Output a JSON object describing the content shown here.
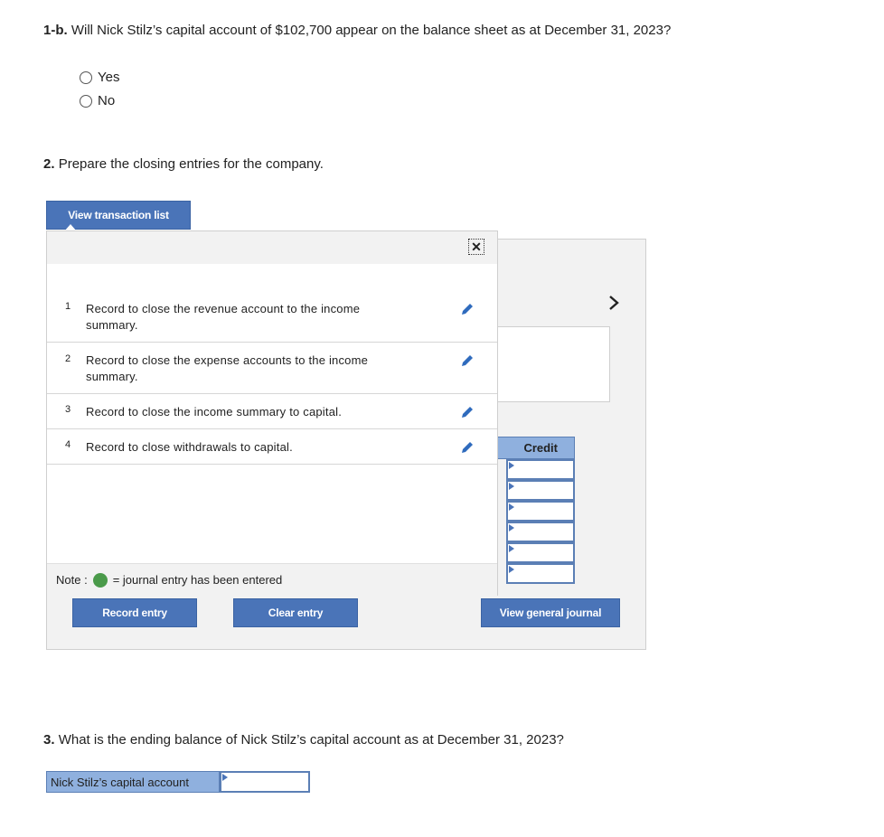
{
  "q1b": {
    "label": "1-b.",
    "text": "Will Nick Stilz’s capital account of $102,700 appear on the balance sheet as at December 31, 2023?",
    "options": [
      "Yes",
      "No"
    ]
  },
  "q2": {
    "label": "2.",
    "text": "Prepare the closing entries for the company."
  },
  "buttons": {
    "view_transaction_list": "View transaction list",
    "record_entry": "Record entry",
    "clear_entry": "Clear entry",
    "view_general_journal": "View general journal"
  },
  "overlay": {
    "close_symbol": "✕",
    "rows": [
      {
        "num": "1",
        "text": "Record to close the revenue account to the income summary."
      },
      {
        "num": "2",
        "text": "Record to close the expense accounts to the income summary."
      },
      {
        "num": "3",
        "text": "Record to close the income summary to capital."
      },
      {
        "num": "4",
        "text": "Record to close withdrawals to capital."
      }
    ],
    "note_label": "Note :",
    "note_text": "= journal entry has been entered",
    "note_dot_color": "#4a9a4a"
  },
  "journal": {
    "next_arrow": "›",
    "credit_header": "Credit"
  },
  "q3": {
    "label": "3.",
    "text": "What is the ending balance of Nick Stilz’s capital account as at December 31, 2023?",
    "field_label": "Nick Stilz’s capital account",
    "field_value": ""
  },
  "colors": {
    "accent": "#4a74b8",
    "header_blue": "#8fb0de",
    "pencil": "#2f6bbd"
  }
}
